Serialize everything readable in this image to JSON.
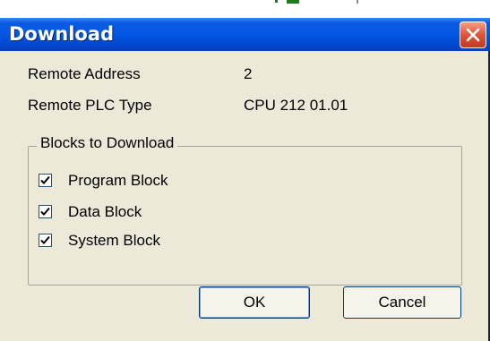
{
  "window": {
    "title": "Download"
  },
  "info": {
    "remote_address_label": "Remote Address",
    "remote_address_value": "2",
    "remote_plc_type_label": "Remote PLC Type",
    "remote_plc_type_value": "CPU 212 01.01"
  },
  "blocks": {
    "legend": "Blocks to Download",
    "items": [
      {
        "label": "Program Block",
        "checked": true
      },
      {
        "label": "Data Block",
        "checked": true
      },
      {
        "label": "System Block",
        "checked": true
      }
    ]
  },
  "buttons": {
    "ok_label": "OK",
    "cancel_label": "Cancel"
  },
  "icons": {
    "close": "close-icon",
    "check": "checkmark-icon"
  },
  "colors": {
    "titlebar": "#0558e6",
    "close_button": "#e0543a",
    "dialog_background": "#ece9d8"
  }
}
